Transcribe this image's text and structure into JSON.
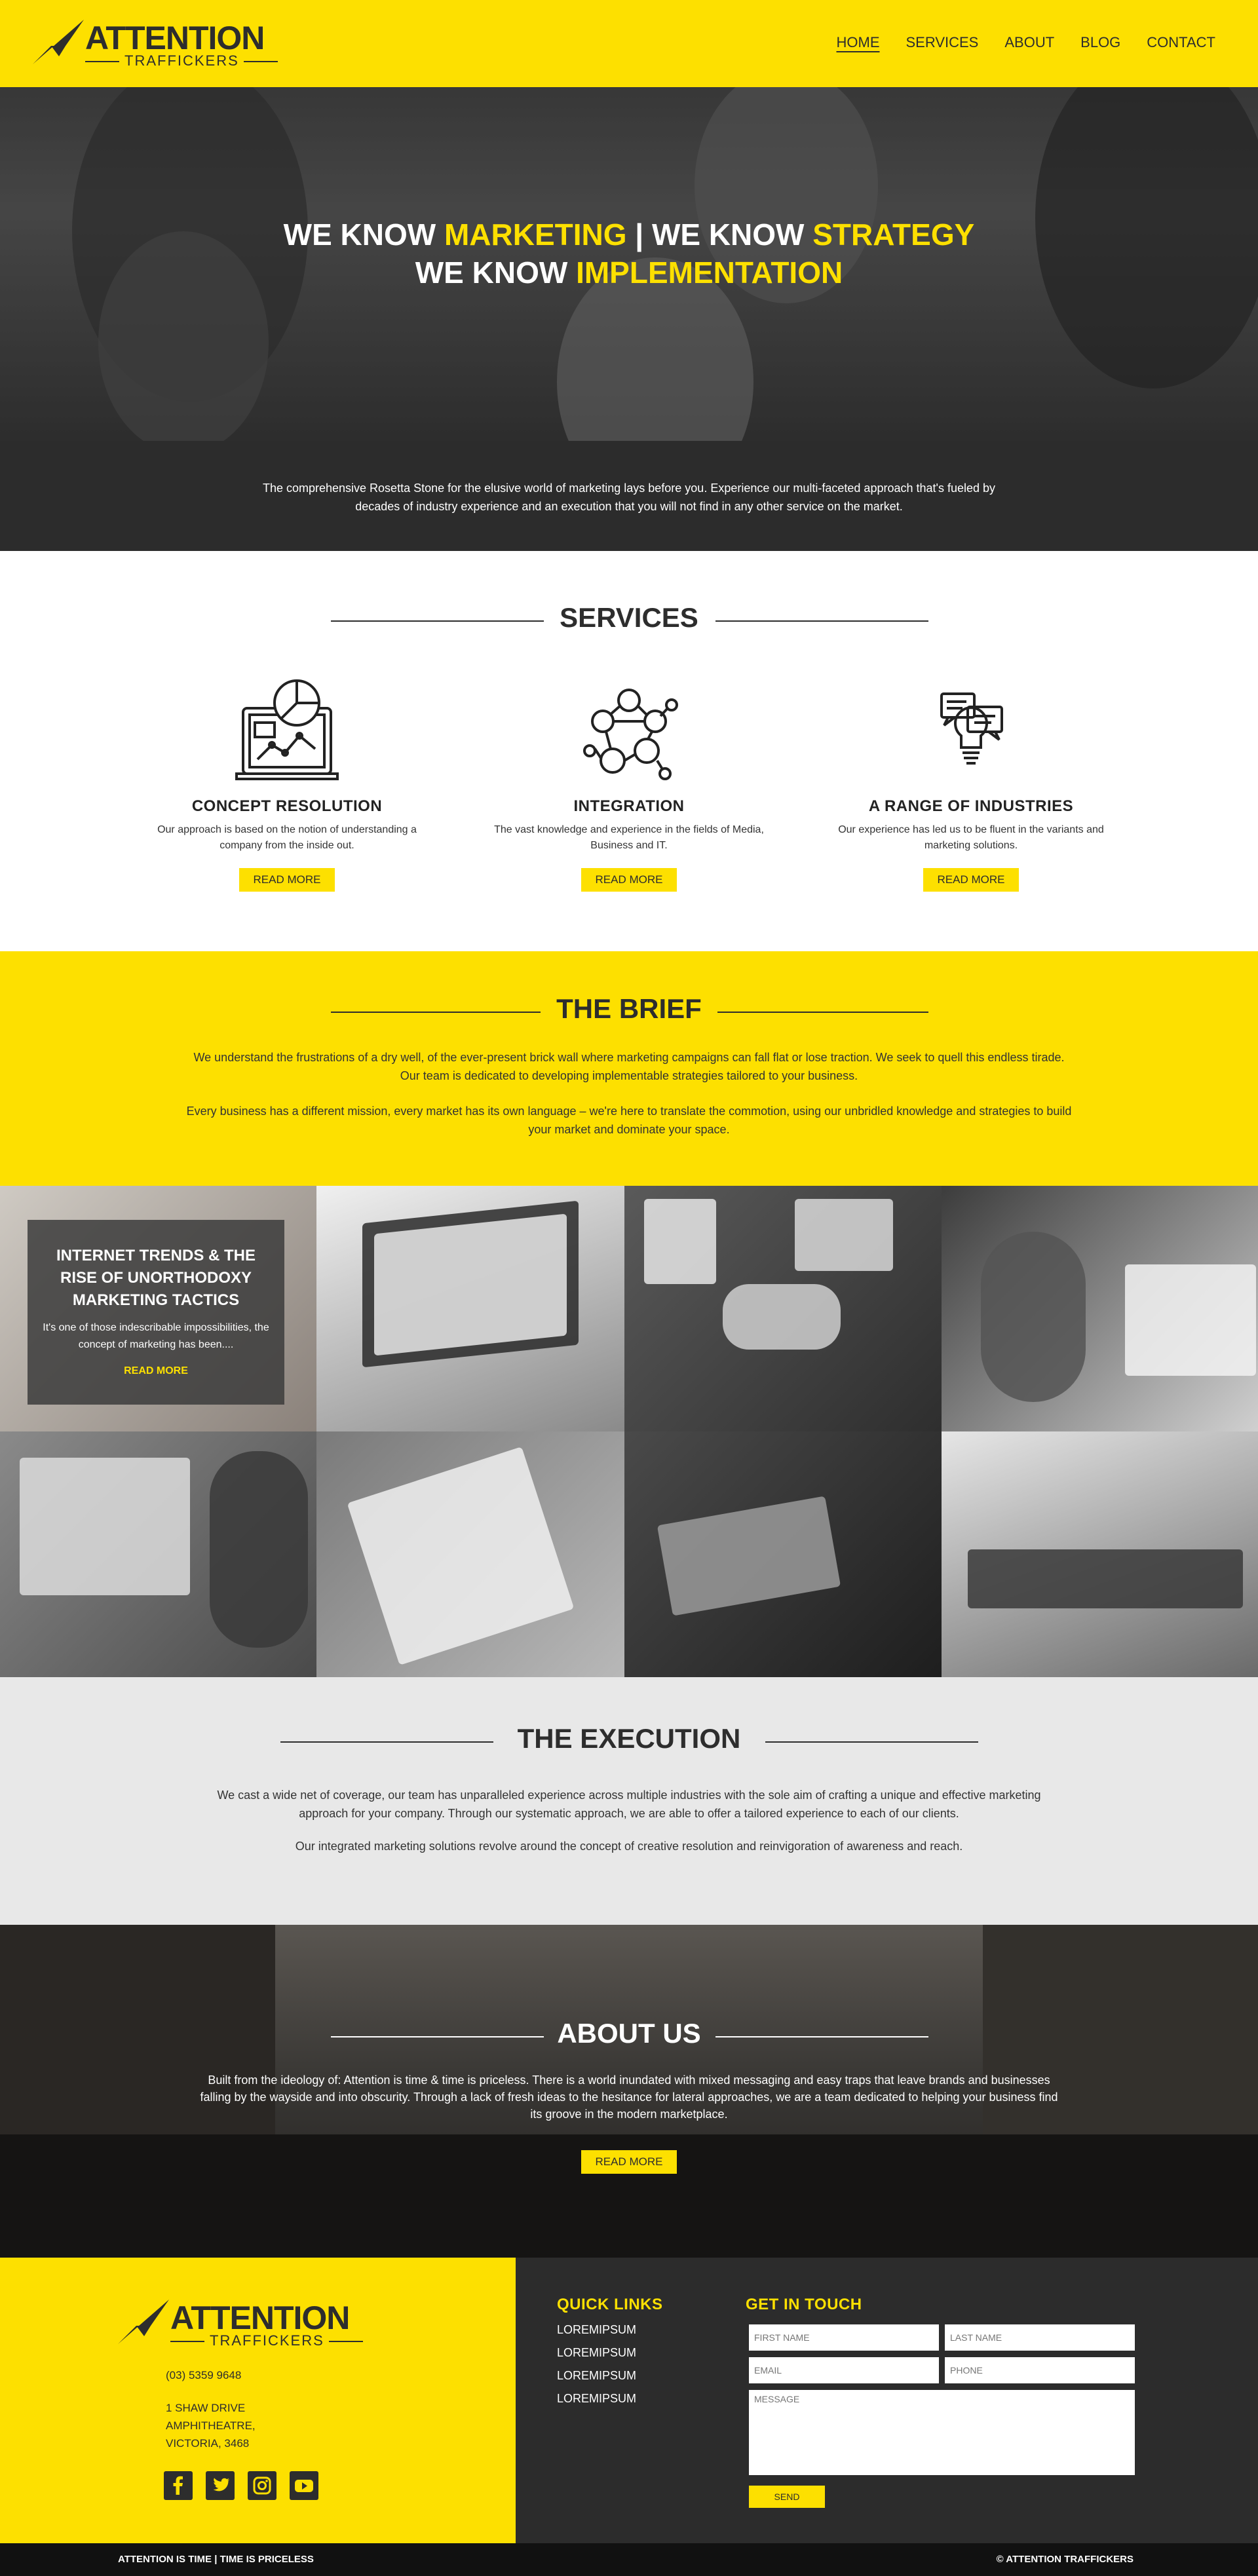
{
  "brand": {
    "name": "ATTENTION",
    "tagline": "TRAFFICKERS"
  },
  "nav": {
    "home": "HOME",
    "services": "SERVICES",
    "about": "ABOUT",
    "blog": "BLOG",
    "contact": "CONTACT"
  },
  "hero": {
    "line1_a": "WE KNOW ",
    "line1_b": "MARKETING",
    "line1_c": " | WE KNOW ",
    "line1_d": "STRATEGY",
    "line2_a": "WE KNOW ",
    "line2_b": "IMPLEMENTATION"
  },
  "intro": {
    "text": "The comprehensive Rosetta Stone for the elusive world of marketing lays before you. Experience our multi-faceted approach that's fueled  by decades of industry experience and an execution that you will not find in any other service on the market."
  },
  "services": {
    "title": "SERVICES",
    "items": [
      {
        "title": "CONCEPT RESOLUTION",
        "text": "Our approach is based on the notion of understanding a company from the inside out.",
        "button": "READ MORE",
        "icon": "laptop-chart-icon"
      },
      {
        "title": "INTEGRATION",
        "text": "The vast knowledge and experience in the fields of Media, Business and IT.",
        "button": "READ MORE",
        "icon": "network-people-icon"
      },
      {
        "title": "A RANGE OF INDUSTRIES",
        "text": "Our experience has led us to be fluent in the variants and marketing solutions.",
        "button": "READ MORE",
        "icon": "lightbulb-chat-icon"
      }
    ]
  },
  "brief": {
    "title": "THE BRIEF",
    "p1": "We understand the frustrations of a dry well, of the ever-present brick wall where marketing campaigns can fall flat or lose traction. We seek to quell this endless tirade.  Our team is dedicated to developing implementable strategies tailored to your business.",
    "p2": "Every business has a different mission, every market has its own language – we're here to translate the commotion, using our unbridled knowledge and strategies to build your market and dominate your space."
  },
  "blog_card": {
    "title": "INTERNET TRENDS & THE RISE OF UNORTHODOXY MARKETING TACTICS",
    "excerpt": "It's one of those indescribable impossibilities, the concept of marketing has been....",
    "link": "READ MORE"
  },
  "execution": {
    "title": "THE EXECUTION",
    "p1": "We cast a wide net of coverage, our team has unparalleled experience across multiple industries with the sole aim of crafting a unique and effective marketing approach for your company. Through our systematic approach, we are able to offer a tailored experience to each of our clients.",
    "p2": "Our integrated marketing solutions revolve around the concept of creative resolution and reinvigoration of awareness and reach."
  },
  "about": {
    "title": "ABOUT US",
    "text": "Built from the ideology of: Attention is time & time is priceless. There is a world inundated with mixed messaging and easy traps that leave brands and businesses falling by the wayside and into obscurity. Through a lack of fresh ideas to the hesitance for lateral approaches, we are a team dedicated to helping your business find its groove in the modern marketplace.",
    "button": "READ MORE"
  },
  "footer": {
    "phone": "(03) 5359 9648",
    "address1": "1 SHAW DRIVE",
    "address2": "AMPHITHEATRE,",
    "address3": "VICTORIA, 3468",
    "quick_links_title": "QUICK LINKS",
    "links": [
      "LOREMIPSUM",
      "LOREMIPSUM",
      "LOREMIPSUM",
      "LOREMIPSUM"
    ],
    "contact_title": "GET IN TOUCH",
    "first_name": "FIRST NAME",
    "last_name": "LAST NAME",
    "email": "EMAIL",
    "phone_ph": "PHONE",
    "message": "MESSAGE",
    "send": "SEND",
    "bottom_left": "ATTENTION IS TIME | TIME IS PRICELESS",
    "bottom_right": "© ATTENTION TRAFFICKERS"
  },
  "colors": {
    "accent": "#fde000",
    "dark": "#2c2c2c",
    "light": "#e8e8e8"
  }
}
